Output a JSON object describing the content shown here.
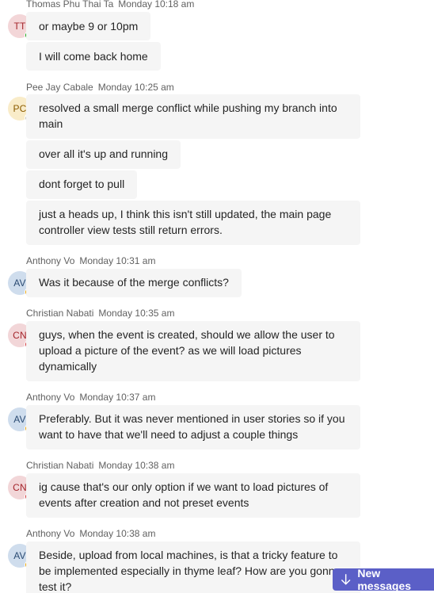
{
  "messages": [
    {
      "sender": "Thomas Phu Thai Ta",
      "time": "Monday 10:18 am",
      "initials": "TT",
      "presence": "available",
      "lines": [
        "or maybe 9 or 10pm",
        "I will come back home"
      ]
    },
    {
      "sender": "Pee Jay Cabale",
      "time": "Monday 10:25 am",
      "initials": "PC",
      "presence": "offline",
      "lines": [
        "resolved a small merge conflict while pushing my branch into main",
        "over all it's up and running",
        "dont forget to pull",
        "just a heads up, I think this isn't still updated, the main page controller view tests still return errors."
      ]
    },
    {
      "sender": "Anthony Vo",
      "time": "Monday 10:31 am",
      "initials": "AV",
      "presence": "away",
      "lines": [
        "Was it because of the merge conflicts?"
      ]
    },
    {
      "sender": "Christian Nabati",
      "time": "Monday 10:35 am",
      "initials": "CN",
      "presence": "busy",
      "lines": [
        "guys, when the event is created, should we allow the user to upload a picture of the event? as we will load pictures dynamically"
      ]
    },
    {
      "sender": "Anthony Vo",
      "time": "Monday 10:37 am",
      "initials": "AV",
      "presence": "away",
      "lines": [
        "Preferably. But it was never mentioned in user stories so if you want to have that we'll need to adjust a couple things"
      ]
    },
    {
      "sender": "Christian Nabati",
      "time": "Monday 10:38 am",
      "initials": "CN",
      "presence": "busy",
      "lines": [
        "ig cause that's our only option if we want to load pictures of events after creation and not preset events"
      ]
    },
    {
      "sender": "Anthony Vo",
      "time": "Monday 10:38 am",
      "initials": "AV",
      "presence": "away",
      "lines": [
        "Beside, upload from local machines, is that a tricky feature to be implemented especially in thyme leaf? How are you gonna test it?"
      ]
    }
  ],
  "new_messages_label": "New messages",
  "colors": {
    "accent": "#5b5fc7",
    "bubble": "#f5f5f5",
    "available": "#13a10e",
    "away": "#eaa300",
    "busy": "#d13438",
    "offline": "#8a8886"
  }
}
